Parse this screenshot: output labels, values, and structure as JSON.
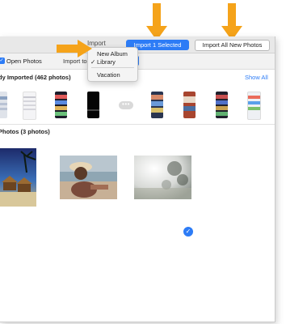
{
  "window": {
    "title": "Import",
    "import_selected_label": "Import 1 Selected",
    "import_all_label": "Import All New Photos"
  },
  "toolbar": {
    "open_photos_label": "Open Photos",
    "open_photos_checked": true,
    "import_to_label": "Import to"
  },
  "menu": {
    "items": [
      {
        "label": "New Album",
        "checked": false
      },
      {
        "label": "Library",
        "checked": true
      },
      {
        "label": "Vacation",
        "checked": false
      }
    ],
    "checkmark": "✓"
  },
  "already_imported": {
    "title": "dy Imported (462 photos)",
    "show_all_label": "Show All",
    "more_glyph": "•••"
  },
  "new_photos": {
    "title": "Photos (3 photos)",
    "selected_badge": "✓"
  },
  "colors": {
    "accent": "#2d7cf6",
    "arrow": "#f5a31a"
  },
  "icons": [
    "down-arrow-annotation",
    "right-arrow-annotation",
    "checkmark-icon",
    "more-icon"
  ]
}
